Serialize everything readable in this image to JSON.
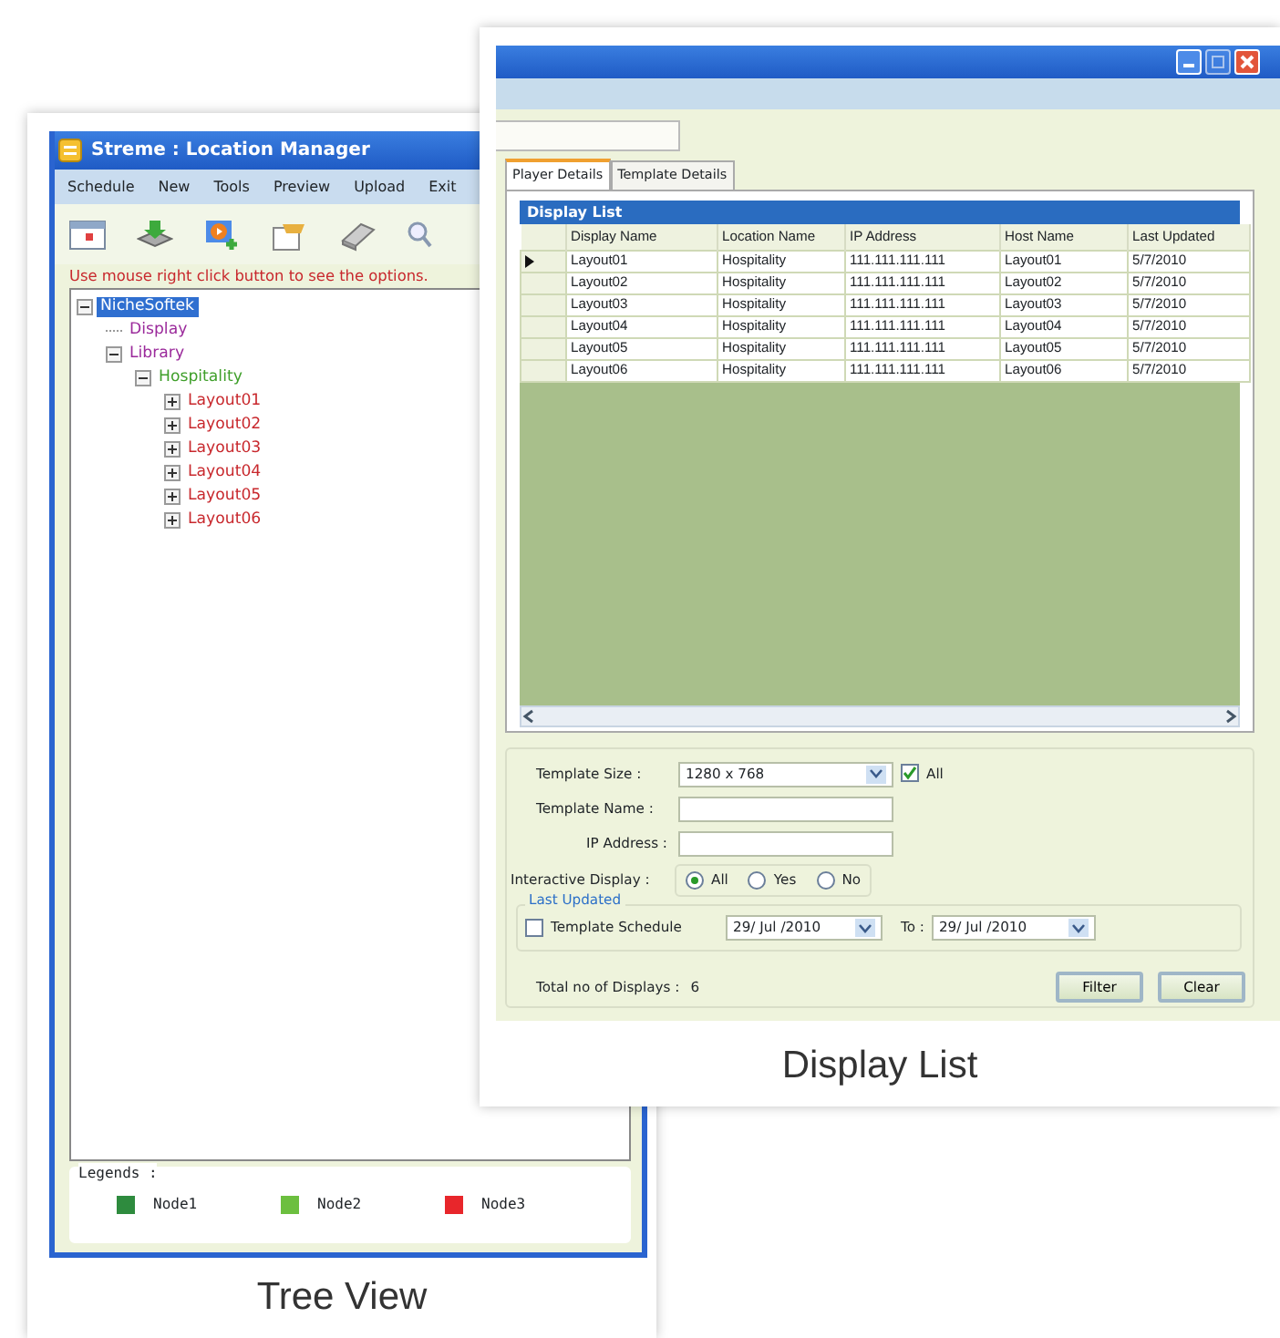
{
  "tree_view": {
    "window": {
      "title": "Streme : Location Manager"
    },
    "menu": [
      "Schedule",
      "New",
      "Tools",
      "Preview",
      "Upload",
      "Exit"
    ],
    "hint": "Use mouse right click button to see the options.",
    "tree": [
      {
        "label": "NicheSoftek",
        "kind": "branch",
        "expanded": true,
        "selected": true,
        "children": [
          {
            "label": "Display",
            "kind": "leaf",
            "selected": false,
            "color": "#9b2a9b"
          },
          {
            "label": "Library",
            "kind": "branch",
            "expanded": true,
            "selected": false,
            "color": "#9b2a9b",
            "children": [
              {
                "label": "Hospitality",
                "kind": "branch",
                "expanded": true,
                "selected": false,
                "color": "#3f9f2a",
                "children": [
                  {
                    "label": "Layout01",
                    "kind": "branch",
                    "expanded": false,
                    "selected": false,
                    "color": "#c8282d"
                  },
                  {
                    "label": "Layout02",
                    "kind": "branch",
                    "expanded": false,
                    "selected": false,
                    "color": "#c8282d"
                  },
                  {
                    "label": "Layout03",
                    "kind": "branch",
                    "expanded": false,
                    "selected": false,
                    "color": "#c8282d"
                  },
                  {
                    "label": "Layout04",
                    "kind": "branch",
                    "expanded": false,
                    "selected": false,
                    "color": "#c8282d"
                  },
                  {
                    "label": "Layout05",
                    "kind": "branch",
                    "expanded": false,
                    "selected": false,
                    "color": "#c8282d"
                  },
                  {
                    "label": "Layout06",
                    "kind": "branch",
                    "expanded": false,
                    "selected": false,
                    "color": "#c8282d"
                  }
                ]
              }
            ]
          }
        ]
      }
    ],
    "legends": {
      "title": "Legends :",
      "items": [
        {
          "label": "Node1",
          "color": "#2e8b3e"
        },
        {
          "label": "Node2",
          "color": "#6cbf3f"
        },
        {
          "label": "Node3",
          "color": "#e8262b"
        }
      ]
    },
    "caption": "Tree View"
  },
  "display_list": {
    "tabs": [
      {
        "label": "Player Details",
        "selected": true
      },
      {
        "label": "Template Details",
        "selected": false
      }
    ],
    "grid": {
      "title": "Display List",
      "columns": [
        "Display Name",
        "Location Name",
        "IP Address",
        "Host Name",
        "Last Updated"
      ],
      "rows": [
        {
          "selected": true,
          "cells": [
            "Layout01",
            "Hospitality",
            "111.111.111.111",
            "Layout01",
            "5/7/2010"
          ]
        },
        {
          "selected": false,
          "cells": [
            "Layout02",
            "Hospitality",
            "111.111.111.111",
            "Layout02",
            "5/7/2010"
          ]
        },
        {
          "selected": false,
          "cells": [
            "Layout03",
            "Hospitality",
            "111.111.111.111",
            "Layout03",
            "5/7/2010"
          ]
        },
        {
          "selected": false,
          "cells": [
            "Layout04",
            "Hospitality",
            "111.111.111.111",
            "Layout04",
            "5/7/2010"
          ]
        },
        {
          "selected": false,
          "cells": [
            "Layout05",
            "Hospitality",
            "111.111.111.111",
            "Layout05",
            "5/7/2010"
          ]
        },
        {
          "selected": false,
          "cells": [
            "Layout06",
            "Hospitality",
            "111.111.111.111",
            "Layout06",
            "5/7/2010"
          ]
        }
      ]
    },
    "filter": {
      "template_size": {
        "label": "Template Size   :",
        "value": "1280 x 768",
        "all_label": "All",
        "all_checked": true
      },
      "template_name": {
        "label": "Template Name :"
      },
      "ip_address": {
        "label": "IP Address  :"
      },
      "interactive_display": {
        "label": "Interactive Display :",
        "options": [
          {
            "label": "All",
            "selected": true
          },
          {
            "label": "Yes",
            "selected": false
          },
          {
            "label": "No",
            "selected": false
          }
        ]
      },
      "last_updated": {
        "title": "Last Updated",
        "schedule_label": "Template Schedule",
        "schedule_checked": false,
        "from": "29/ Jul /2010",
        "to_label": "To :",
        "to": "29/ Jul /2010"
      },
      "total_label": "Total no of Displays  :",
      "total": "6",
      "buttons": [
        "Filter",
        "Clear"
      ]
    },
    "caption": "Display List"
  }
}
